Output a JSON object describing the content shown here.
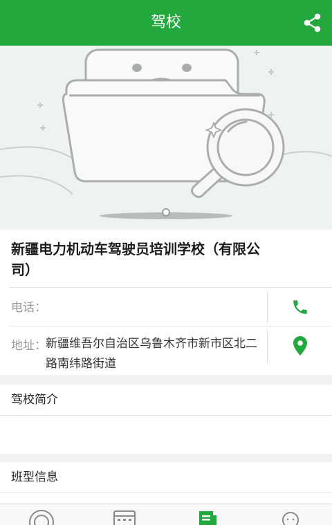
{
  "appbar": {
    "title": "驾校",
    "share_icon": "share-icon"
  },
  "school": {
    "name": "新疆电力机动车驾驶员培训学校（有限公司）",
    "phone_label": "电话：",
    "address_label": "地址：",
    "address": "新疆维吾尔自治区乌鲁木齐市新市区北二路南纬路街道"
  },
  "sections": {
    "intro_title": "驾校简介",
    "class_title": "班型信息"
  },
  "colors": {
    "brand": "#22a83c",
    "background": "#f2f2f2"
  },
  "tabs": [
    {
      "icon": "steering-wheel-icon"
    },
    {
      "icon": "calendar-icon"
    },
    {
      "icon": "document-icon",
      "active": true
    },
    {
      "icon": "user-icon"
    }
  ]
}
